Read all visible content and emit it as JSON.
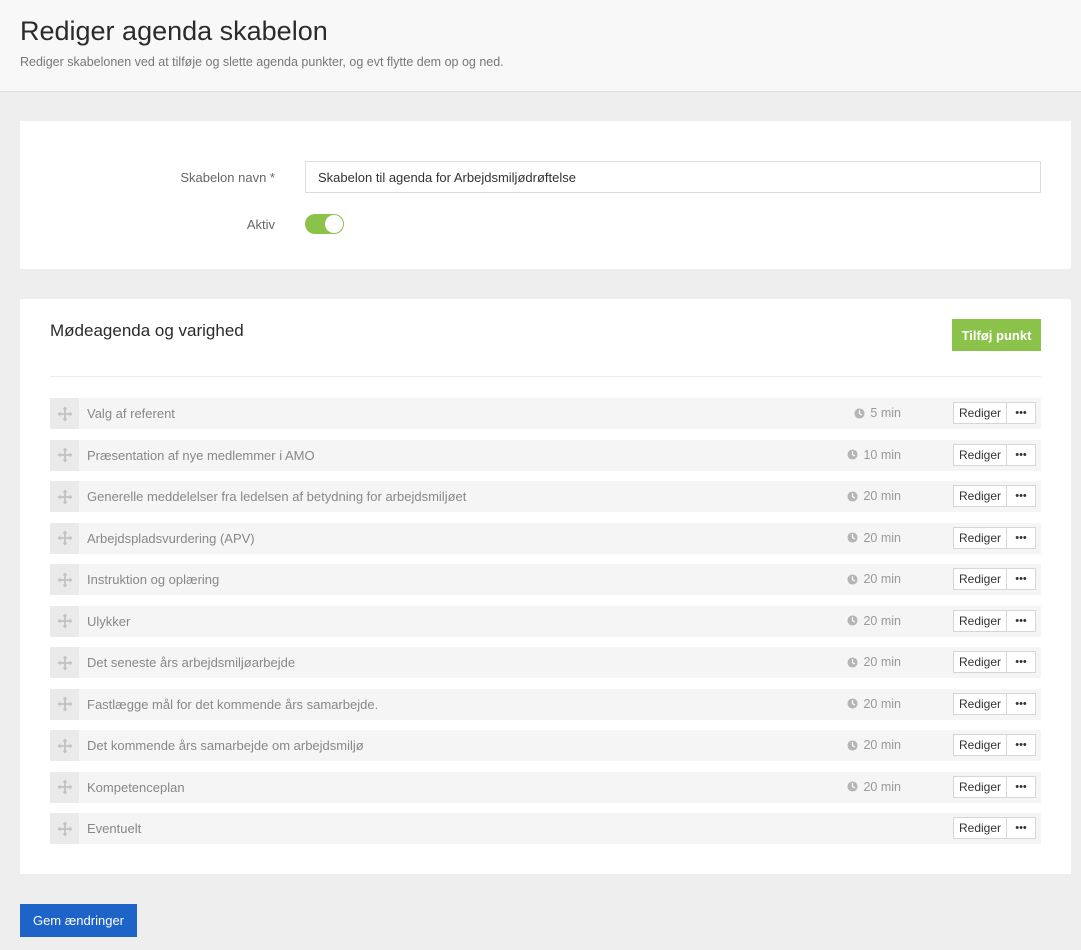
{
  "header": {
    "title": "Rediger agenda skabelon",
    "subtitle": "Rediger skabelonen ved at tilføje og slette agenda punkter, og evt flytte dem op og ned."
  },
  "settings": {
    "name_label": "Skabelon navn *",
    "name_value": "Skabelon til agenda for Arbejdsmiljødrøftelse",
    "active_label": "Aktiv",
    "active": true
  },
  "agenda": {
    "title": "Mødeagenda og varighed",
    "add_label": "Tilføj punkt",
    "edit_label": "Rediger",
    "more_label": "•••",
    "items": [
      {
        "title": "Valg af referent",
        "duration": "5 min"
      },
      {
        "title": "Præsentation af nye medlemmer i AMO",
        "duration": "10 min"
      },
      {
        "title": "Generelle meddelelser fra ledelsen af betydning for arbejdsmiljøet",
        "duration": "20 min"
      },
      {
        "title": "Arbejdspladsvurdering (APV)",
        "duration": "20 min"
      },
      {
        "title": "Instruktion og oplæring",
        "duration": "20 min"
      },
      {
        "title": "Ulykker",
        "duration": "20 min"
      },
      {
        "title": "Det seneste års arbejdsmiljøarbejde",
        "duration": "20 min"
      },
      {
        "title": "Fastlægge mål for det kommende års samarbejde.",
        "duration": "20 min"
      },
      {
        "title": "Det kommende års samarbejde om arbejdsmiljø",
        "duration": "20 min"
      },
      {
        "title": "Kompetenceplan",
        "duration": "20 min"
      },
      {
        "title": "Eventuelt",
        "duration": ""
      }
    ]
  },
  "footer": {
    "save_label": "Gem ændringer"
  },
  "colors": {
    "accent_green": "#8bc34a",
    "primary_blue": "#1e64c8"
  },
  "icons": {
    "drag": "move-icon",
    "duration": "clock-icon"
  }
}
